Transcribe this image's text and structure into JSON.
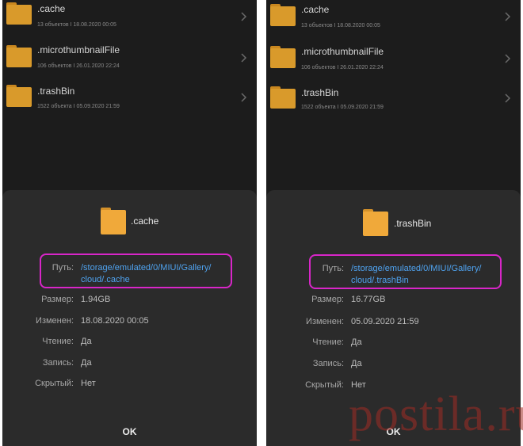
{
  "colors": {
    "background": "#1c1c1c",
    "sheet": "#2b2b2b",
    "folder": "#d99a2b",
    "path_link": "#4fa3f0",
    "highlight_border": "#d826c8",
    "watermark": "#a12b24"
  },
  "left": {
    "files": [
      {
        "name": ".cache",
        "meta": "13 объектов  I  18.08.2020 00:05"
      },
      {
        "name": ".microthumbnailFile",
        "meta": "106 объектов  I  26.01.2020 22:24"
      },
      {
        "name": ".trashBin",
        "meta": "1522 объекта  I  05.09.2020 21:59"
      }
    ],
    "dialog": {
      "title": ".cache",
      "path_label": "Путь:",
      "path_line1": "/storage/emulated/0/MIUI/Gallery/",
      "path_line2": "cloud/.cache",
      "size_label": "Размер:",
      "size_value": "1.94GB",
      "modified_label": "Изменен:",
      "modified_value": "18.08.2020 00:05",
      "read_label": "Чтение:",
      "read_value": "Да",
      "write_label": "Запись:",
      "write_value": "Да",
      "hidden_label": "Скрытый:",
      "hidden_value": "Нет",
      "ok_label": "OK"
    }
  },
  "right": {
    "files": [
      {
        "name": ".cache",
        "meta": "13 объектов  I  18.08.2020 00:05"
      },
      {
        "name": ".microthumbnailFile",
        "meta": "106 объектов  I  26.01.2020 22:24"
      },
      {
        "name": ".trashBin",
        "meta": "1522 объекта  I  05.09.2020 21:59"
      }
    ],
    "dialog": {
      "title": ".trashBin",
      "path_label": "Путь:",
      "path_line1": "/storage/emulated/0/MIUI/Gallery/",
      "path_line2": "cloud/.trashBin",
      "size_label": "Размер:",
      "size_value": "16.77GB",
      "modified_label": "Изменен:",
      "modified_value": "05.09.2020 21:59",
      "read_label": "Чтение:",
      "read_value": "Да",
      "write_label": "Запись:",
      "write_value": "Да",
      "hidden_label": "Скрытый:",
      "hidden_value": "Нет",
      "ok_label": "OK"
    }
  },
  "watermark": "postila.ru"
}
